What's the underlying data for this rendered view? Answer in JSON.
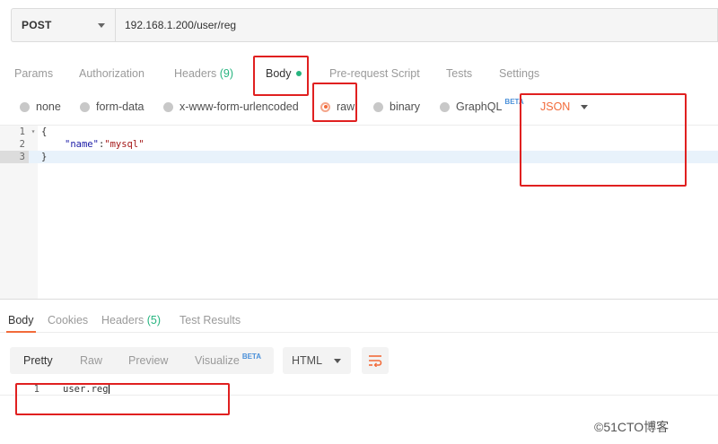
{
  "request": {
    "method": "POST",
    "url": "192.168.1.200/user/reg"
  },
  "request_tabs": {
    "params": "Params",
    "authorization": "Authorization",
    "headers": "Headers",
    "headers_count": "(9)",
    "body": "Body",
    "prerequest": "Pre-request Script",
    "tests": "Tests",
    "settings": "Settings"
  },
  "body_types": {
    "none": "none",
    "form_data": "form-data",
    "urlencoded": "x-www-form-urlencoded",
    "raw": "raw",
    "binary": "binary",
    "graphql": "GraphQL",
    "graphql_badge": "BETA",
    "selected": "raw",
    "language": "JSON"
  },
  "editor": {
    "lines": [
      {
        "n": "1",
        "text": "{"
      },
      {
        "n": "2",
        "key": "\"name\"",
        "sep": ":",
        "value": "\"mysql\""
      },
      {
        "n": "3",
        "text": "}"
      }
    ],
    "active_line": 3
  },
  "response_tabs": {
    "body": "Body",
    "cookies": "Cookies",
    "headers": "Headers",
    "headers_count": "(5)",
    "test_results": "Test Results"
  },
  "response_view": {
    "pretty": "Pretty",
    "raw": "Raw",
    "preview": "Preview",
    "visualize": "Visualize",
    "visualize_badge": "BETA",
    "format": "HTML"
  },
  "response_body": {
    "line_number": "1",
    "text": "user.reg"
  },
  "watermark": "©51CTO博客",
  "colors": {
    "accent": "#f26b3a",
    "count_green": "#26b47f",
    "annotation_red": "#e02020",
    "beta_blue": "#4a90d9"
  },
  "icons": {
    "method_dropdown": "chevron-down-icon",
    "language_dropdown": "chevron-down-icon",
    "format_dropdown": "chevron-down-icon",
    "wrap": "wrap-lines-icon",
    "fold": "fold-arrow-icon"
  }
}
